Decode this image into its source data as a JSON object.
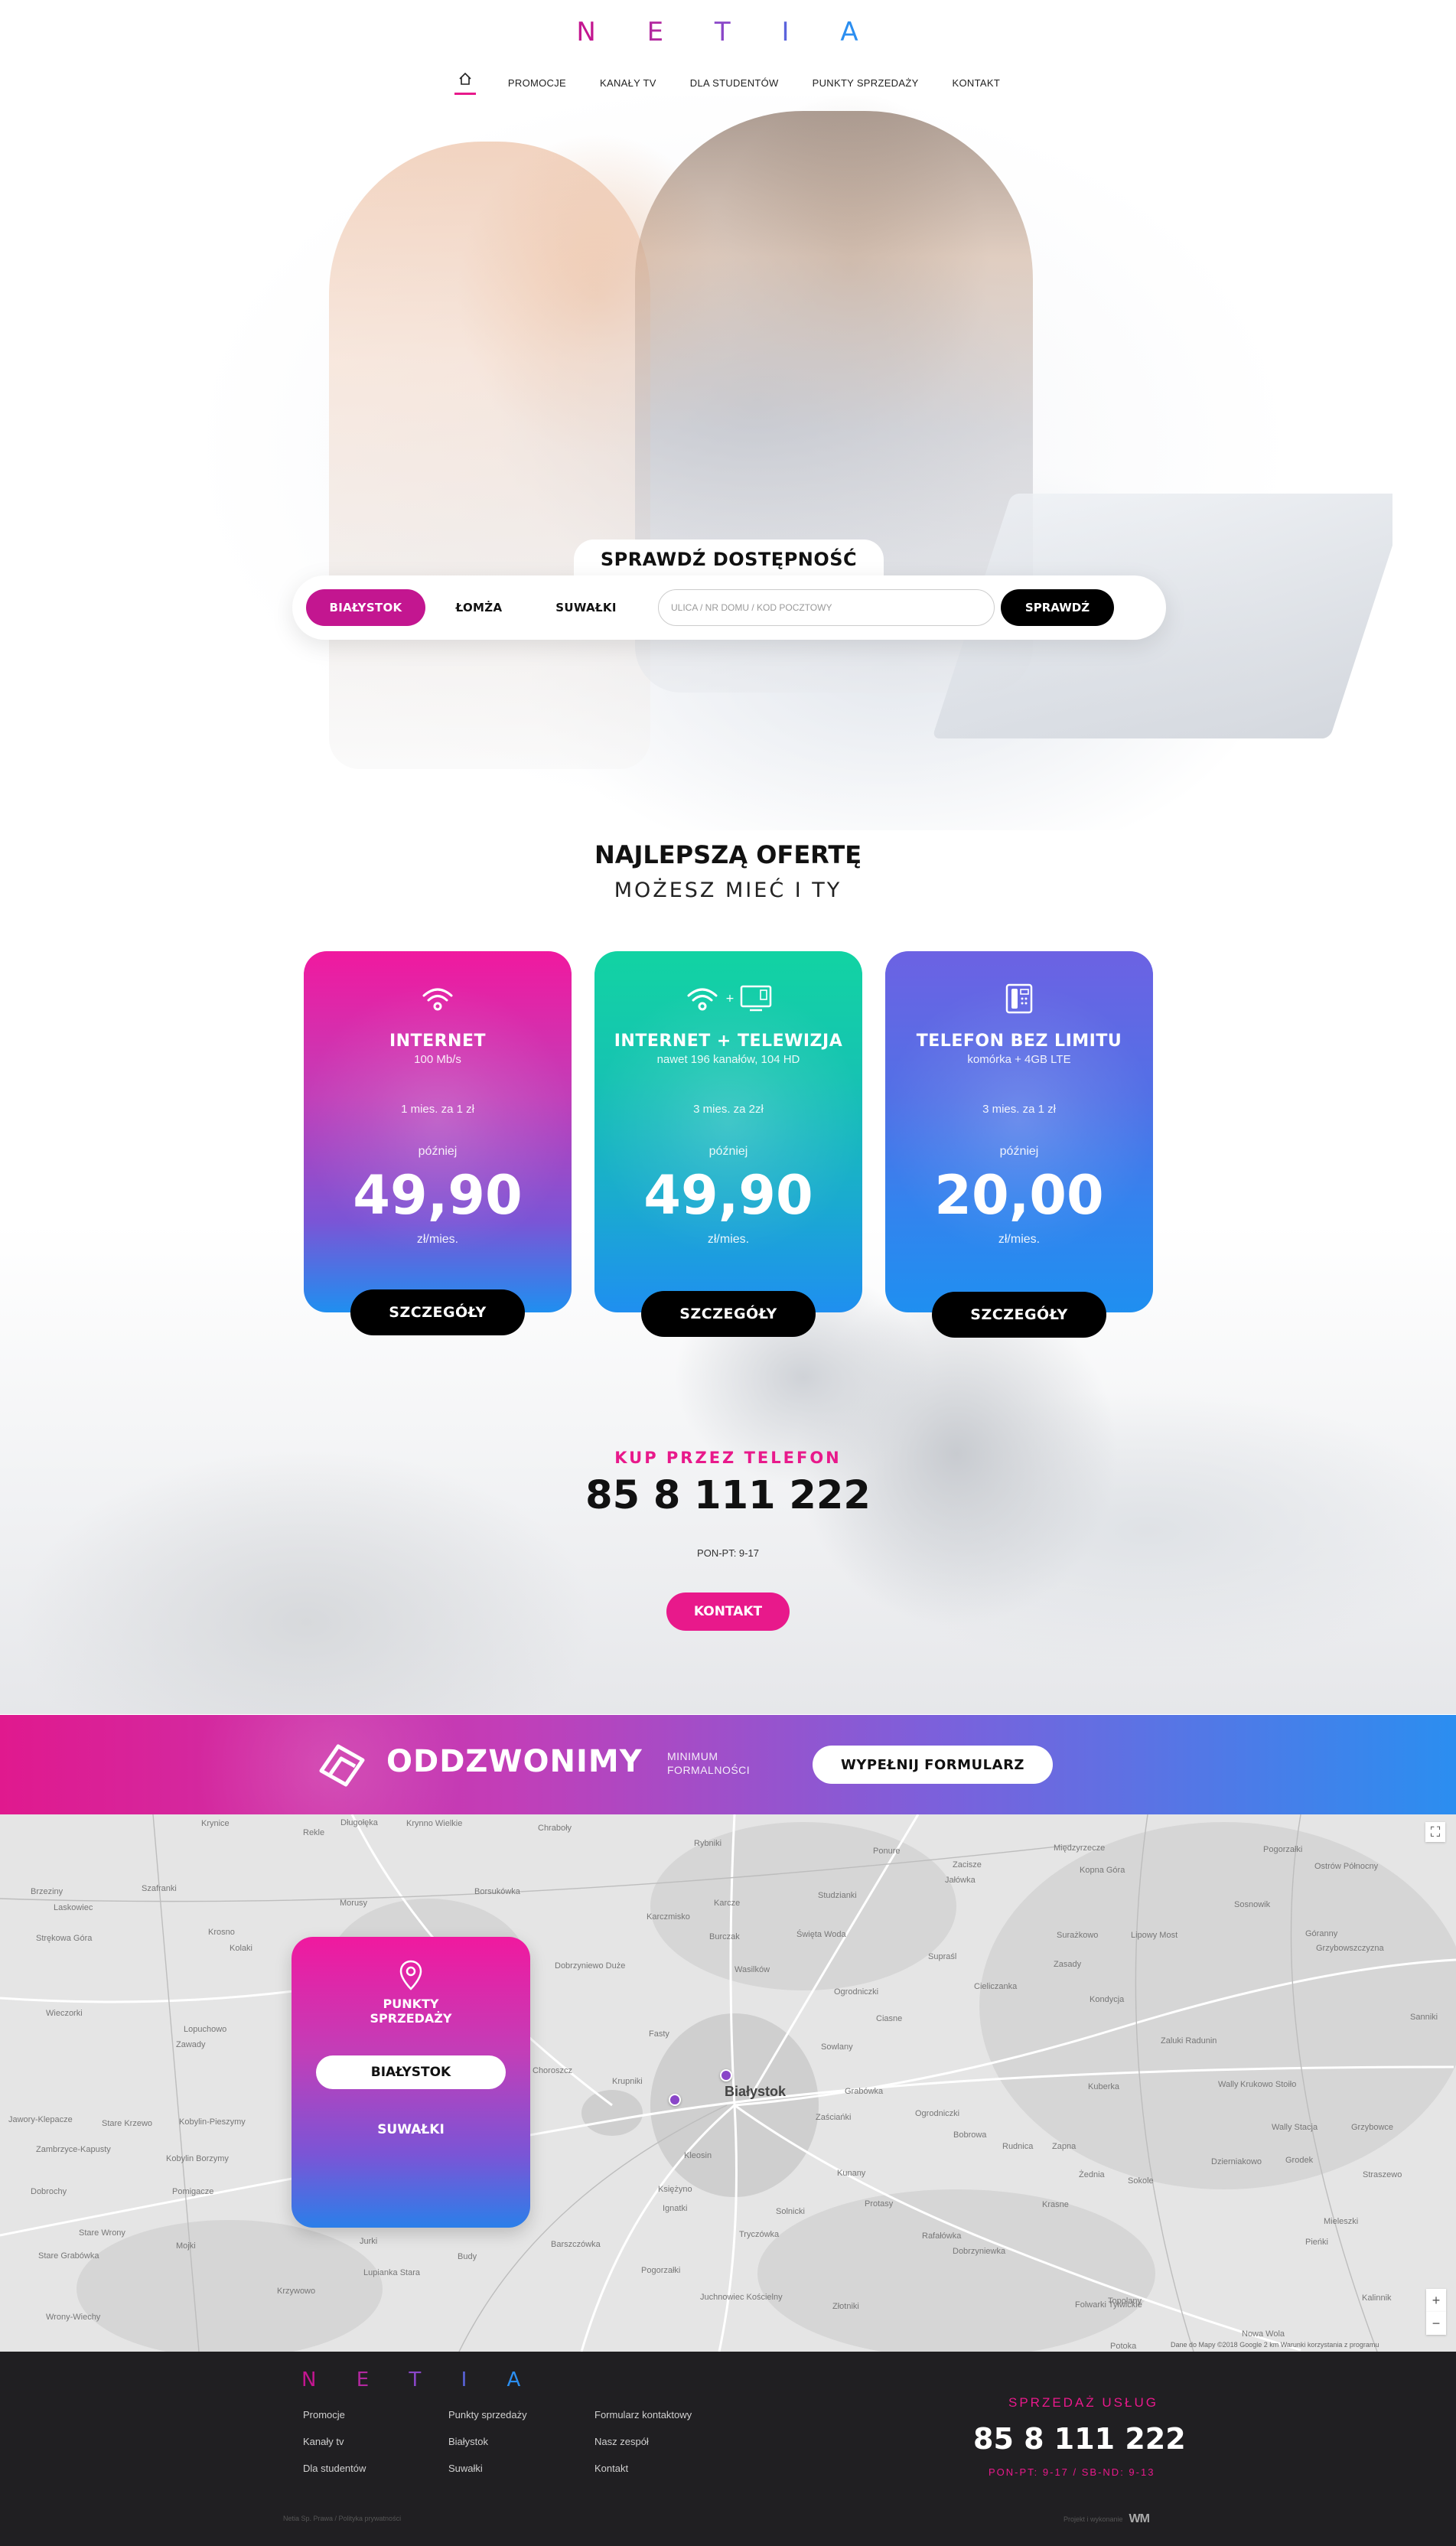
{
  "header": {
    "logo_letters": [
      "N",
      "E",
      "T",
      "I",
      "A"
    ],
    "logo_colors": [
      "#c31690",
      "#b2289f",
      "#8a46c8",
      "#5b64dc",
      "#2b8ef0"
    ],
    "nav": [
      "PROMOCJE",
      "KANAŁY TV",
      "DLA STUDENTÓW",
      "PUNKTY SPRZEDAŻY",
      "KONTAKT"
    ]
  },
  "check": {
    "title": "SPRAWDŹ DOSTĘPNOŚĆ",
    "cities": [
      "BIAŁYSTOK",
      "ŁOMŻA",
      "SUWAŁKI"
    ],
    "active_city": "BIAŁYSTOK",
    "placeholder": "ULICA / NR DOMU / KOD POCZTOWY",
    "button": "SPRAWDŹ"
  },
  "offer": {
    "heading": "NAJLEPSZĄ OFERTĘ",
    "subheading": "MOŻESZ MIEĆ I TY",
    "cards": [
      {
        "title": "INTERNET",
        "sub": "100 Mb/s",
        "promo": "1 mies. za 1 zł",
        "later": "później",
        "price": "49,90",
        "unit": "zł/mies.",
        "button": "SZCZEGÓŁY",
        "icon": "wifi-icon"
      },
      {
        "title": "INTERNET + TELEWIZJA",
        "sub": "nawet 196 kanałów, 104 HD",
        "promo": "3 mies. za 2zł",
        "later": "później",
        "price": "49,90",
        "unit": "zł/mies.",
        "button": "SZCZEGÓŁY",
        "icon": "wifi-tv-icon"
      },
      {
        "title": "TELEFON BEZ LIMITU",
        "sub": "komórka + 4GB LTE",
        "promo": "3 mies. za 1 zł",
        "later": "później",
        "price": "20,00",
        "unit": "zł/mies.",
        "button": "SZCZEGÓŁY",
        "icon": "phone-icon"
      }
    ]
  },
  "phone_cta": {
    "label": "KUP PRZEZ TELEFON",
    "phone": "85 8 111 222",
    "hours": "PON-PT: 9-17",
    "button": "KONTAKT"
  },
  "callback": {
    "title": "ODDZWONIMY",
    "minimum_line1": "MINIMUM",
    "minimum_line2": "FORMALNOŚCI",
    "button": "WYPEŁNIJ FORMULARZ"
  },
  "map": {
    "main_city": "Białystok",
    "labels": [
      "Krynice",
      "Rekle",
      "Długołęka",
      "Krynno Wielkie",
      "Chraboły",
      "Rybniki",
      "Ponure",
      "Zacisze",
      "Jałówka",
      "Międzyrzecze",
      "Kopna Góra",
      "Pogorzałki",
      "Ostrów Północny",
      "Brzeziny",
      "Szafranki",
      "Laskowiec",
      "Morusy",
      "Borsukówka",
      "Karcze",
      "Studzianki",
      "Karczmisko",
      "Sosnowik",
      "Strękowa Góra",
      "Krosno",
      "Kolaki",
      "Burczak",
      "Świętа Woda",
      "Surażkowo",
      "Lipowy Most",
      "Góranny",
      "Grzybowszczyzna",
      "Ciasne",
      "Wasilków",
      "Supraśl",
      "Cieliczanka",
      "Zasady",
      "Kondycja",
      "Sanniki",
      "Wieczorki",
      "Lopuchowo",
      "Dobrzyniewo Duże",
      "Fasty",
      "Ogrodniczki",
      "Zaluki Radunin",
      "Choroszcz",
      "Krupniki",
      "Grabówka",
      "Kuberka",
      "Wally",
      "Krukowo Stoiło",
      "Jawory-Klepacze",
      "Stare Krzewo",
      "Kobylin-Pieszymy",
      "Zawady",
      "Zaściańki",
      "Sowlany",
      "Bobrowa",
      "Ogrodniczki",
      "Wally Stacja",
      "Grzybowce",
      "Zambrzyce-Kapusty",
      "Kobylin Borzymy",
      "Kleosin",
      "Ignatki",
      "Sokole",
      "Dzierniakowo",
      "Kunany",
      "Rudnica",
      "Zapna",
      "Żednia",
      "Grodek",
      "Straszewo",
      "Dobrochy",
      "Pomigacze",
      "Księżyno",
      "Solnicki",
      "Protasy",
      "Rafałówka",
      "Krasne",
      "Pieńki",
      "Mieleszki",
      "Stare Wrony",
      "Mojki",
      "Jurki",
      "Barszczówka",
      "Tryczówka",
      "Dobrzyniewka",
      "Kalinnik",
      "Stare Grabówka",
      "Budy",
      "Pogorzałki",
      "Topolany",
      "Nowa Wola",
      "Potoka",
      "Wrony-Wiechy",
      "Lupianka Stara",
      "Krzywowo",
      "Juchnowiec Kościelny",
      "Złotniki",
      "Folwarki Tylwickie"
    ],
    "legal": "Dane do Mapy ©2018 Google  2 km  Warunki korzystania z programu"
  },
  "points": {
    "title_line1": "PUNKTY",
    "title_line2": "SPRZEDAŻY",
    "active": "BIAŁYSTOK",
    "other": "SUWAŁKI"
  },
  "footer": {
    "col1": [
      "Promocje",
      "Kanały tv",
      "Dla studentów"
    ],
    "col2": [
      "Punkty sprzedaży",
      "Białystok",
      "Suwałki"
    ],
    "col3": [
      "Formularz kontaktowy",
      "Nasz zespół",
      "Kontakt"
    ],
    "sales_label": "SPRZEDAŻ USŁUG",
    "sales_phone": "85 8 111 222",
    "sales_hours": "PON-PT: 9-17 / SB-ND: 9-13",
    "copyright": "Netia Sp. Prawa / Polityka prywatności",
    "designer_label": "Projekt i wykonanie",
    "designer_mark": "WM"
  }
}
